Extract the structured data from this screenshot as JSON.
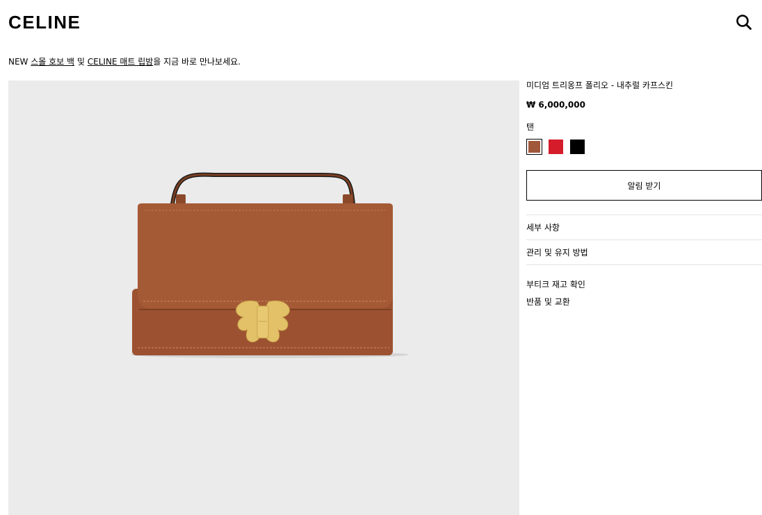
{
  "header": {
    "logo": "CELINE",
    "search_icon": "search-icon"
  },
  "promo": {
    "prefix": "NEW ",
    "link1": "스몰 호보 백",
    "middle": " 및 ",
    "link2": "CELINE 매트 립밤",
    "suffix": "을 지금 바로 만나보세요."
  },
  "product": {
    "name": "미디엄 트리옹프 폴리오 - 내추럴 카프스킨",
    "price": "₩ 6,000,000",
    "color_label": "탠",
    "swatches": [
      {
        "name": "tan",
        "color": "#a0583a",
        "selected": true
      },
      {
        "name": "red",
        "color": "#d41c2b",
        "selected": false
      },
      {
        "name": "black",
        "color": "#000000",
        "selected": false
      }
    ],
    "notify_button": "알림 받기",
    "accordion": [
      "세부 사항",
      "관리 및 유지 방법"
    ],
    "links": [
      "부티크 재고 확인",
      "반품 및 교환"
    ]
  },
  "colors": {
    "image_bg": "#ebebeb",
    "leather": "#a55a36",
    "hardware": "#e3c168"
  }
}
